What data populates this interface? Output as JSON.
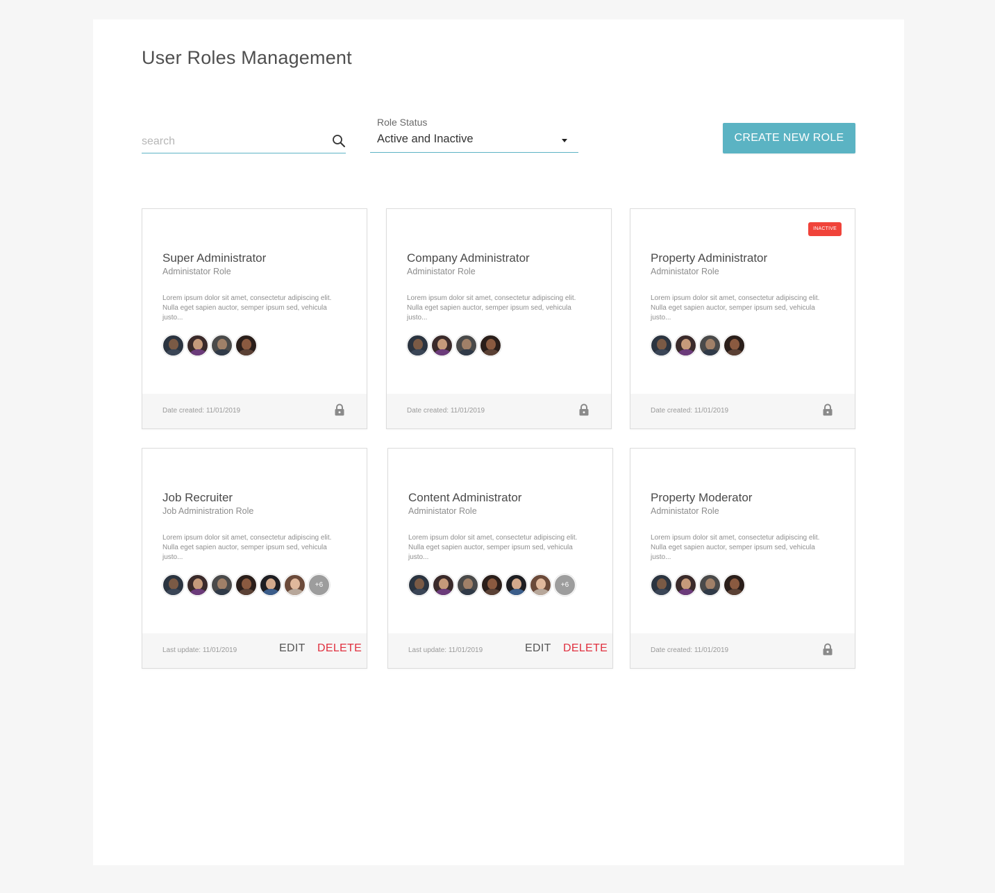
{
  "page": {
    "title": "User Roles Management"
  },
  "filters": {
    "search_placeholder": "search",
    "search_icon": "search-icon",
    "status_label": "Role Status",
    "status_value": "Active and Inactive"
  },
  "actions": {
    "create_label": "CREATE NEW ROLE"
  },
  "colors": {
    "accent": "#5bb3c3",
    "danger": "#e0303f",
    "badge": "#f0433a"
  },
  "cards": [
    {
      "title": "Super Administrator",
      "subtitle": "Administator Role",
      "description": "Lorem ipsum dolor sit amet, consectetur adipiscing elit. Nulla eget sapien auctor, semper ipsum sed, vehicula justo...",
      "avatar_count": 4,
      "more_label": "",
      "footer_text": "Date created: 11/01/2019",
      "locked": true,
      "edit_label": "",
      "delete_label": "",
      "badge": ""
    },
    {
      "title": "Company Administrator",
      "subtitle": "Administator Role",
      "description": "Lorem ipsum dolor sit amet, consectetur adipiscing elit. Nulla eget sapien auctor, semper ipsum sed, vehicula justo...",
      "avatar_count": 4,
      "more_label": "",
      "footer_text": "Date created: 11/01/2019",
      "locked": true,
      "edit_label": "",
      "delete_label": "",
      "badge": ""
    },
    {
      "title": "Property Administrator",
      "subtitle": "Administator Role",
      "description": "Lorem ipsum dolor sit amet, consectetur adipiscing elit. Nulla eget sapien auctor, semper ipsum sed, vehicula justo...",
      "avatar_count": 4,
      "more_label": "",
      "footer_text": "Date created: 11/01/2019",
      "locked": true,
      "edit_label": "",
      "delete_label": "",
      "badge": "INACTIVE"
    },
    {
      "title": "Job Recruiter",
      "subtitle": "Job Administration Role",
      "description": "Lorem ipsum dolor sit amet, consectetur adipiscing elit. Nulla eget sapien auctor, semper ipsum sed, vehicula justo...",
      "avatar_count": 6,
      "more_label": "+6",
      "footer_text": "Last update: 11/01/2019",
      "locked": false,
      "edit_label": "EDIT",
      "delete_label": "DELETE",
      "badge": ""
    },
    {
      "title": "Content Administrator",
      "subtitle": "Administator Role",
      "description": "Lorem ipsum dolor sit amet, consectetur adipiscing elit. Nulla eget sapien auctor, semper ipsum sed, vehicula justo...",
      "avatar_count": 6,
      "more_label": "+6",
      "footer_text": "Last update: 11/01/2019",
      "locked": false,
      "edit_label": "EDIT",
      "delete_label": "DELETE",
      "badge": ""
    },
    {
      "title": "Property Moderator",
      "subtitle": "Administator Role",
      "description": "Lorem ipsum dolor sit amet, consectetur adipiscing elit. Nulla eget sapien auctor, semper ipsum sed, vehicula justo...",
      "avatar_count": 4,
      "more_label": "",
      "footer_text": "Date created: 11/01/2019",
      "locked": true,
      "edit_label": "",
      "delete_label": "",
      "badge": ""
    }
  ]
}
